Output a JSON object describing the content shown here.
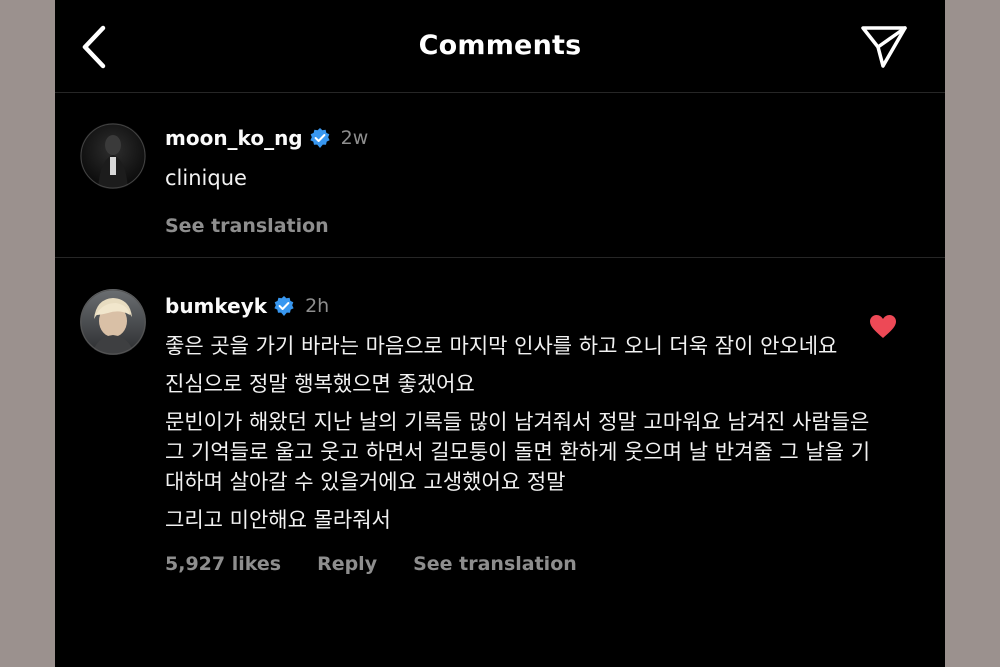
{
  "header": {
    "title": "Comments",
    "back_icon": "chevron-left-icon",
    "share_icon": "paper-plane-icon"
  },
  "comments": [
    {
      "username": "moon_ko_ng",
      "verified": true,
      "time": "2w",
      "text": "clinique",
      "see_translation": "See translation"
    },
    {
      "username": "bumkeyk",
      "verified": true,
      "time": "2h",
      "liked": true,
      "paragraphs": [
        "좋은 곳을 가기 바라는 마음으로 마지막 인사를 하고 오니 더욱 잠이 안오네요",
        "진심으로 정말 행복했으면 좋겠어요",
        "문빈이가 해왔던 지난 날의 기록들 많이 남겨줘서 정말 고마워요 남겨진 사람들은 그 기억들로 울고 웃고 하면서 길모퉁이 돌면 환하게 웃으며 날 반겨줄 그 날을 기대하며 살아갈 수 있을거에요 고생했어요 정말",
        "그리고 미안해요 몰라줘서"
      ],
      "likes": "5,927 likes",
      "reply": "Reply",
      "see_translation": "See translation"
    }
  ],
  "colors": {
    "background": "#000000",
    "secondary_text": "#8e8e8e",
    "verified_blue": "#3897f0",
    "heart_red": "#ed4956"
  }
}
